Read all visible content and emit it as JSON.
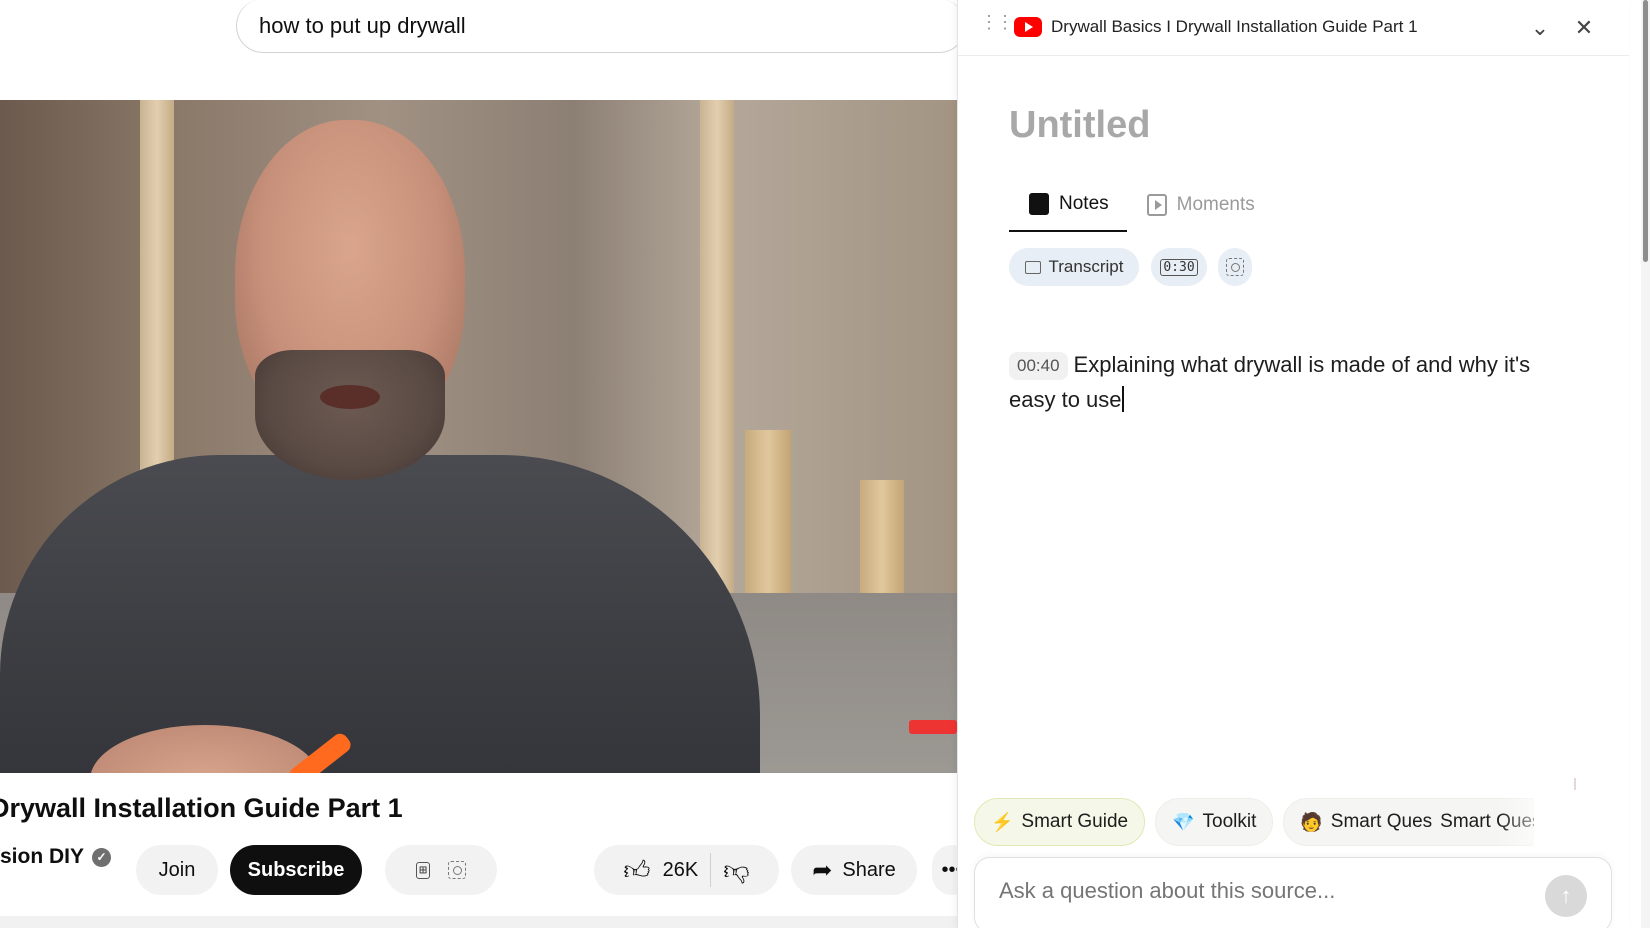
{
  "search": {
    "query": "how to put up drywall"
  },
  "video": {
    "title": "Drywall Installation Guide Part 1",
    "channel": "sion DIY",
    "join_label": "Join",
    "subscribe_label": "Subscribe",
    "likes": "26K",
    "share_label": "Share",
    "more_label": "•••"
  },
  "panel": {
    "header_title": "Drywall Basics I Drywall Installation Guide Part 1",
    "note_title": "Untitled",
    "tabs": [
      {
        "label": "Notes",
        "active": true
      },
      {
        "label": "Moments",
        "active": false
      }
    ],
    "tools": {
      "transcript_label": "Transcript",
      "timestamp_icon": "0:30"
    },
    "note": {
      "timestamp": "00:40",
      "text": "Explaining what drywall is made of and why it's easy to use"
    },
    "suggestions": [
      {
        "icon": "lightning-icon",
        "glyph": "⚡",
        "label": "Smart Guide"
      },
      {
        "icon": "gem-icon",
        "glyph": "💎",
        "label": "Toolkit"
      },
      {
        "icon": "person-icon",
        "glyph": "🧑",
        "label": "Smart Ques"
      },
      {
        "icon": "",
        "glyph": "",
        "label": "Smart Ques"
      }
    ],
    "ask_placeholder": "Ask a question about this source..."
  },
  "colors": {
    "youtube_red": "#ff0000",
    "accent_dark": "#0f0f0f",
    "chip_bg": "#e8eef5"
  }
}
